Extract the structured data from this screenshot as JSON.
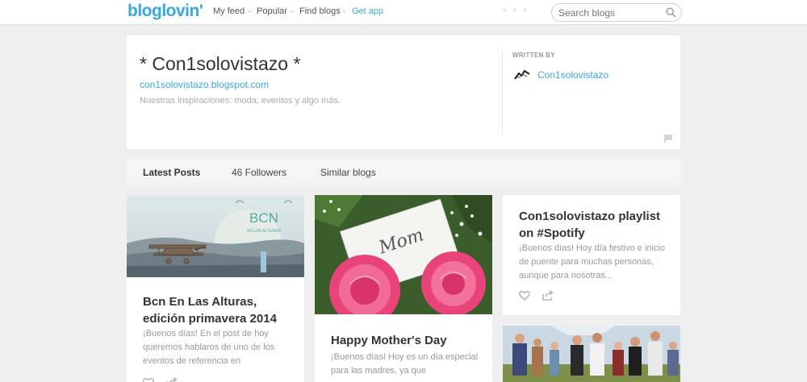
{
  "nav": {
    "logo": "bloglovin'",
    "links": [
      "My feed",
      "Popular",
      "Find blogs"
    ],
    "get_app": "Get app",
    "search_placeholder": "Search blogs"
  },
  "blog": {
    "title": "* Con1solovistazo *",
    "url": "con1solovistazo.blogspot.com",
    "description": "Nuestras inspiraciones: moda, eventos y algo más.",
    "written_by_label": "WRITTEN BY",
    "author": "Con1solovistazo"
  },
  "tabs": [
    "Latest Posts",
    "46 Followers",
    "Similar blogs"
  ],
  "posts": [
    {
      "image_text": "BCN",
      "image_subtext": "EN LAS ALTURAS",
      "title": "Bcn En Las Alturas, edición primavera 2014",
      "excerpt": "¡Buenos días! En el post de hoy queremos hablaros de uno de los eventos de referencia en"
    },
    {
      "image_text": "Mom",
      "title": "Happy Mother's Day",
      "excerpt": "¡Buenos días! Hoy es un día especial para las madres, ya que"
    },
    {
      "title": "Con1solovistazo playlist on #Spotify",
      "excerpt": "¡Buenos días! Hoy día festivo e inicio de puente para muchas personas, aunque para nosotras..."
    }
  ],
  "colors": {
    "accent": "#38a8df",
    "background": "#efefef",
    "text": "#333333",
    "muted": "#999999"
  }
}
